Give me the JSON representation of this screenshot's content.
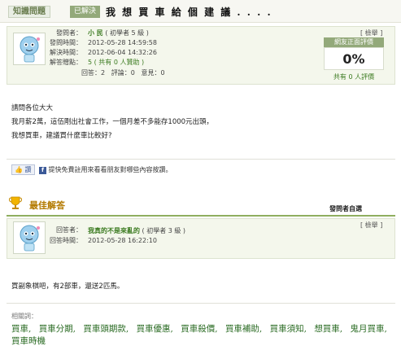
{
  "header": {
    "category": "知識問題",
    "status": "已解決",
    "title": "我 想 買 車 給 個 建 議 . . . ."
  },
  "question_meta": {
    "rows": [
      {
        "label": "發問者：",
        "value": "小 民",
        "extra": "( 初學者 5 級 )"
      },
      {
        "label": "發問時間：",
        "value": "2012-05-28 14:59:58"
      },
      {
        "label": "解決時間：",
        "value": "2012-06-04 14:32:26"
      },
      {
        "label": "解答贈點：",
        "value": "5 ( 共有 0 人贊助 )"
      }
    ],
    "stats": {
      "answer_label": "回答：",
      "answer": "2",
      "comment_label": "評論：",
      "comment": "0",
      "opinion_label": "意見：",
      "opinion": "0"
    },
    "report": "[ 檢舉 ]"
  },
  "rating": {
    "title": "網友正面評價",
    "value": "0%",
    "footer": "共有 0 人評價"
  },
  "question_body": [
    "請問各位大大",
    "我月薪2萬，這伍剛出社會工作，一個月差不多能存1000元出頭，",
    "我想買車，建議買什麼車比較好?"
  ],
  "facebook": {
    "like": "讚",
    "note": "提快免費註用來看看朋友對哪些內容按讚。"
  },
  "best_answer": {
    "title": "最佳解答",
    "asker_pick": "發問者自選",
    "report": "[ 檢舉 ]",
    "answerer_label": "回答者：",
    "answerer": "我真的不是來亂的",
    "answerer_level": "( 初學者 3 級 )",
    "time_label": "回答時間：",
    "time": "2012-05-28 16:22:10",
    "text": "買副象棋吧，有2部車，還送2匹馬。"
  },
  "related": {
    "label": "相關詞：",
    "links": [
      "買車,",
      "買車分期,",
      "買車頭期款,",
      "買車優惠,",
      "買車殺價,",
      "買車補助,",
      "買車須知,",
      "想買車,",
      "鬼月買車,",
      "買車時機"
    ]
  },
  "colors": {
    "accent": "#93a97a",
    "link": "#2a6b23",
    "gold": "#b37a00"
  }
}
